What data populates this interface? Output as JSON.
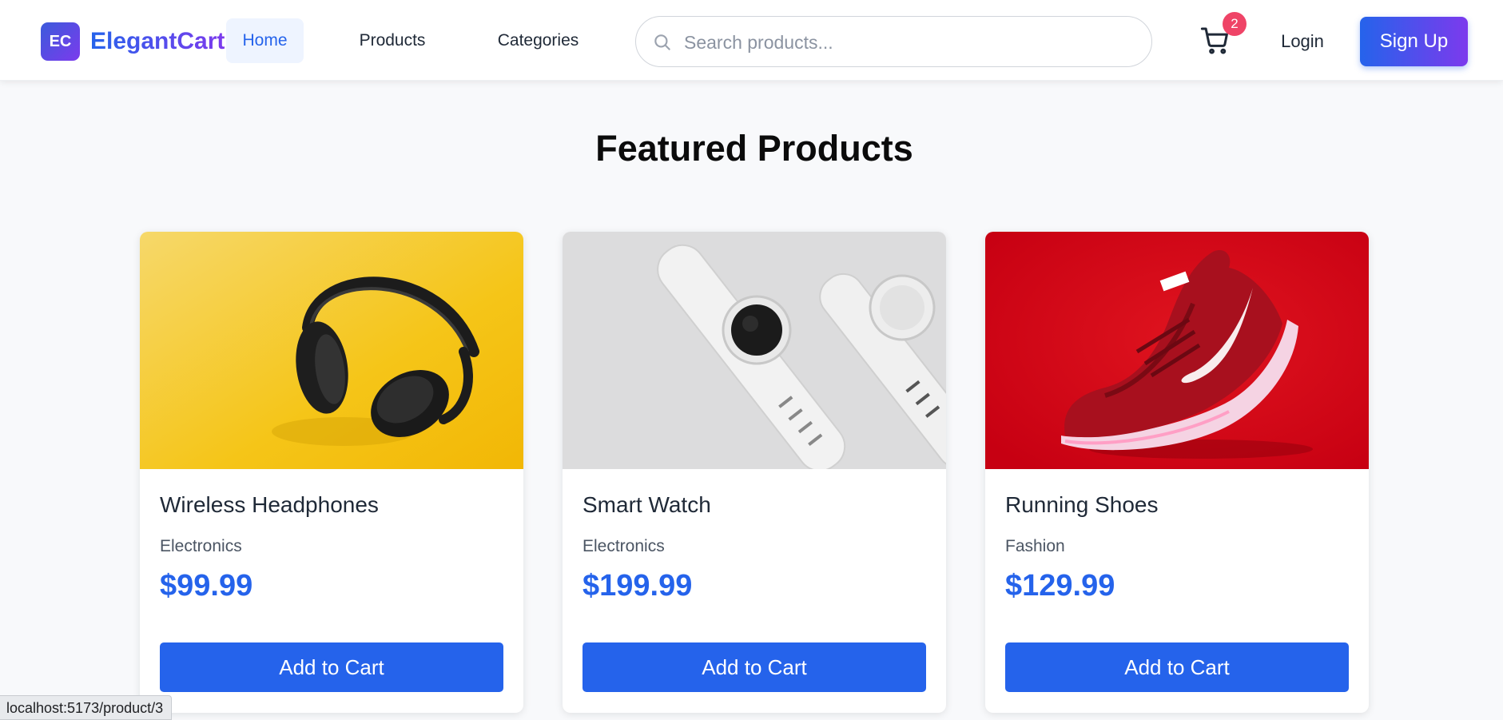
{
  "header": {
    "logo_initials": "EC",
    "logo_text": "ElegantCart",
    "nav": [
      "Home",
      "Products",
      "Categories"
    ],
    "search_placeholder": "Search products...",
    "cart_count": "2",
    "login_label": "Login",
    "signup_label": "Sign Up"
  },
  "main": {
    "title": "Featured Products",
    "products": [
      {
        "name": "Wireless Headphones",
        "category": "Electronics",
        "price": "$99.99",
        "button": "Add to Cart"
      },
      {
        "name": "Smart Watch",
        "category": "Electronics",
        "price": "$199.99",
        "button": "Add to Cart"
      },
      {
        "name": "Running Shoes",
        "category": "Fashion",
        "price": "$129.99",
        "button": "Add to Cart"
      }
    ]
  },
  "status_bar": {
    "url": "localhost:5173/product/3"
  },
  "colors": {
    "accent": "#2563eb",
    "brand_gradient_end": "#7c3aed",
    "badge": "#ef4467",
    "page_bg": "#f8f9fb"
  }
}
